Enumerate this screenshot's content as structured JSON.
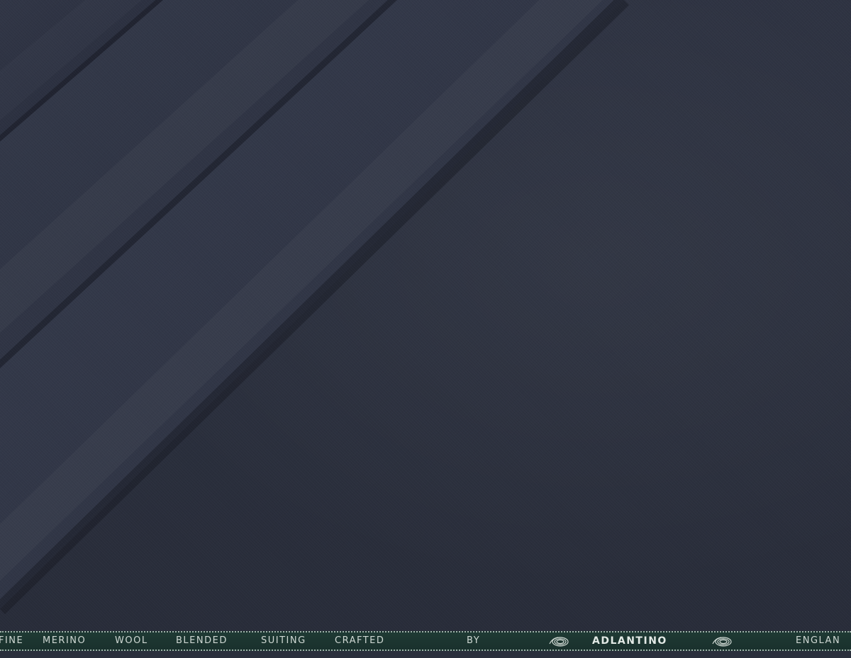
{
  "fabric": {
    "base_color": "#2a2f3d",
    "selvedge_color": "#1c3530",
    "selvedge_text_color": "#cfd8d3"
  },
  "selvedge": {
    "words": [
      "FINE",
      "MERINO",
      "WOOL",
      "BLENDED",
      "SUITING",
      "CRAFTED",
      "BY"
    ],
    "brand": "ADLANTINO",
    "origin": "ENGLAN",
    "logo_icon": "fingerprint-swirl-icon"
  }
}
